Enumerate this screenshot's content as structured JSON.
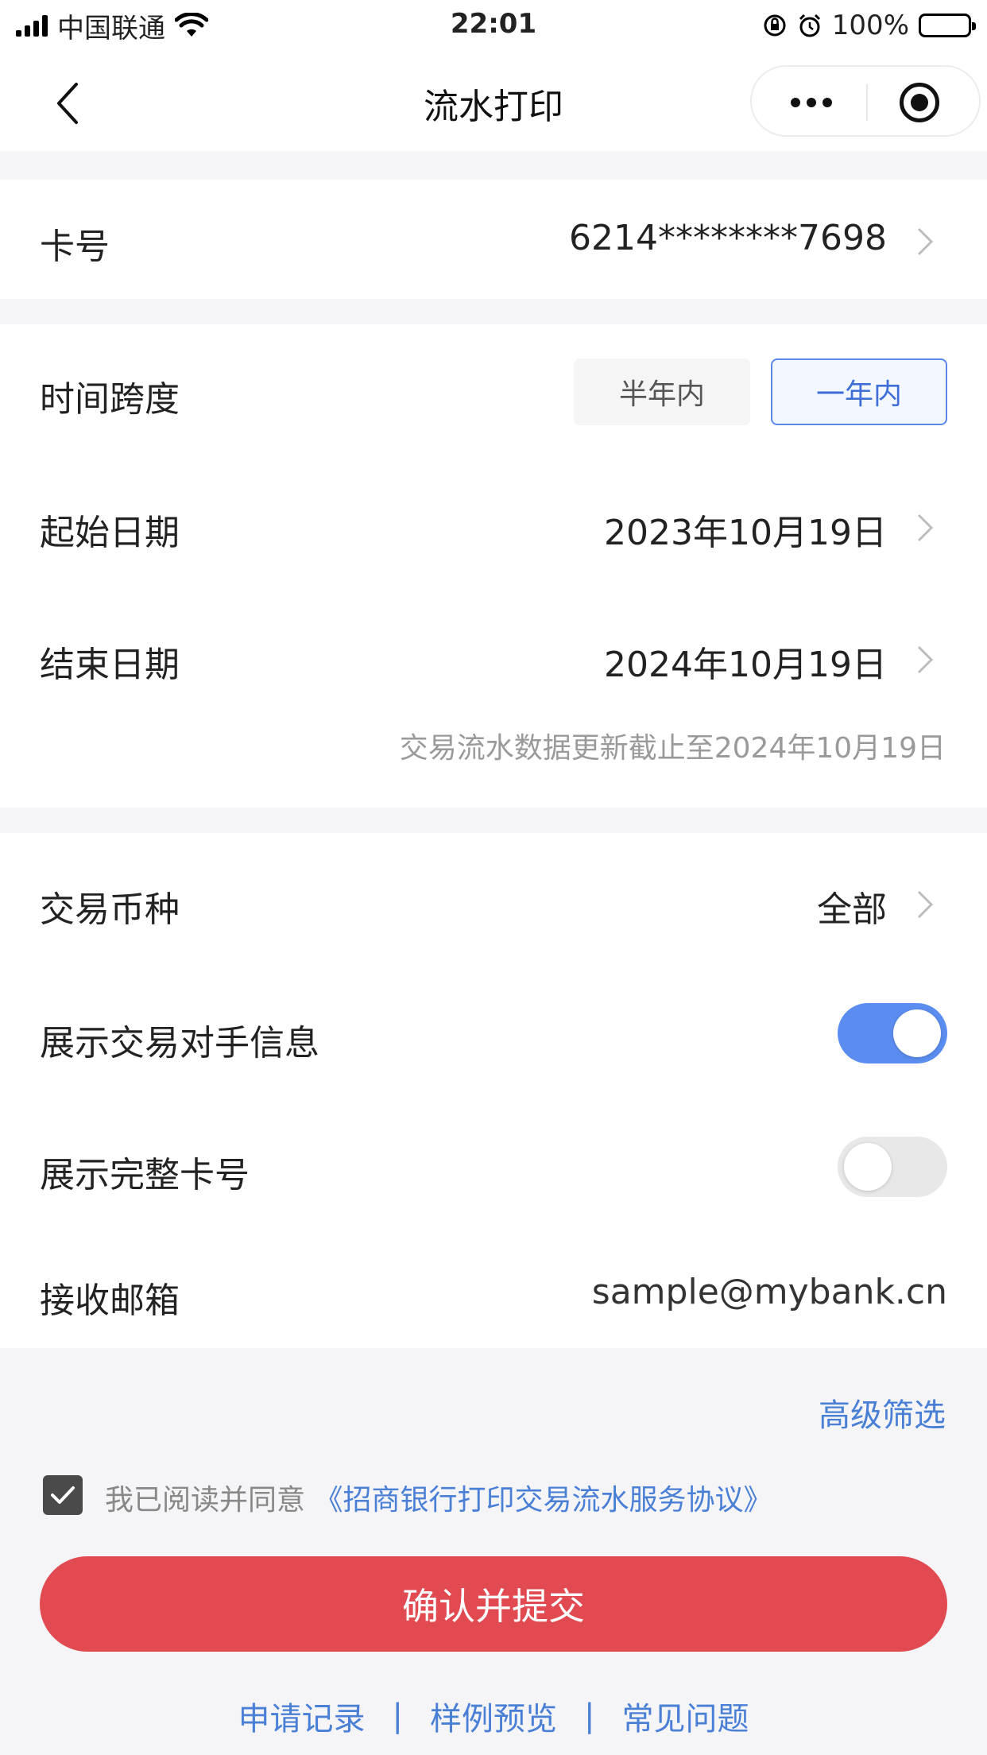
{
  "status_bar": {
    "carrier": "中国联通",
    "time": "22:01",
    "battery": "100%"
  },
  "nav": {
    "title": "流水打印"
  },
  "card_number": {
    "label": "卡号",
    "value": "6214********7698"
  },
  "time_span": {
    "label": "时间跨度",
    "options": [
      "半年内",
      "一年内"
    ],
    "selected": "一年内"
  },
  "start_date": {
    "label": "起始日期",
    "value": "2023年10月19日"
  },
  "end_date": {
    "label": "结束日期",
    "value": "2024年10月19日"
  },
  "data_note": "交易流水数据更新截止至2024年10月19日",
  "currency": {
    "label": "交易币种",
    "value": "全部"
  },
  "show_counterparty": {
    "label": "展示交易对手信息",
    "enabled": true
  },
  "show_full_card": {
    "label": "展示完整卡号",
    "enabled": false
  },
  "email": {
    "label": "接收邮箱",
    "value": "sample@mybank.cn"
  },
  "advanced_filter": "高级筛选",
  "agreement": {
    "checked": true,
    "prefix": "我已阅读并同意",
    "link": "《招商银行打印交易流水服务协议》"
  },
  "submit_label": "确认并提交",
  "footer_links": [
    "申请记录",
    "样例预览",
    "常见问题"
  ],
  "footer_separator": "|",
  "colors": {
    "accent": "#5b8df0",
    "link": "#4a7fd6",
    "submit": "#e24a52"
  }
}
